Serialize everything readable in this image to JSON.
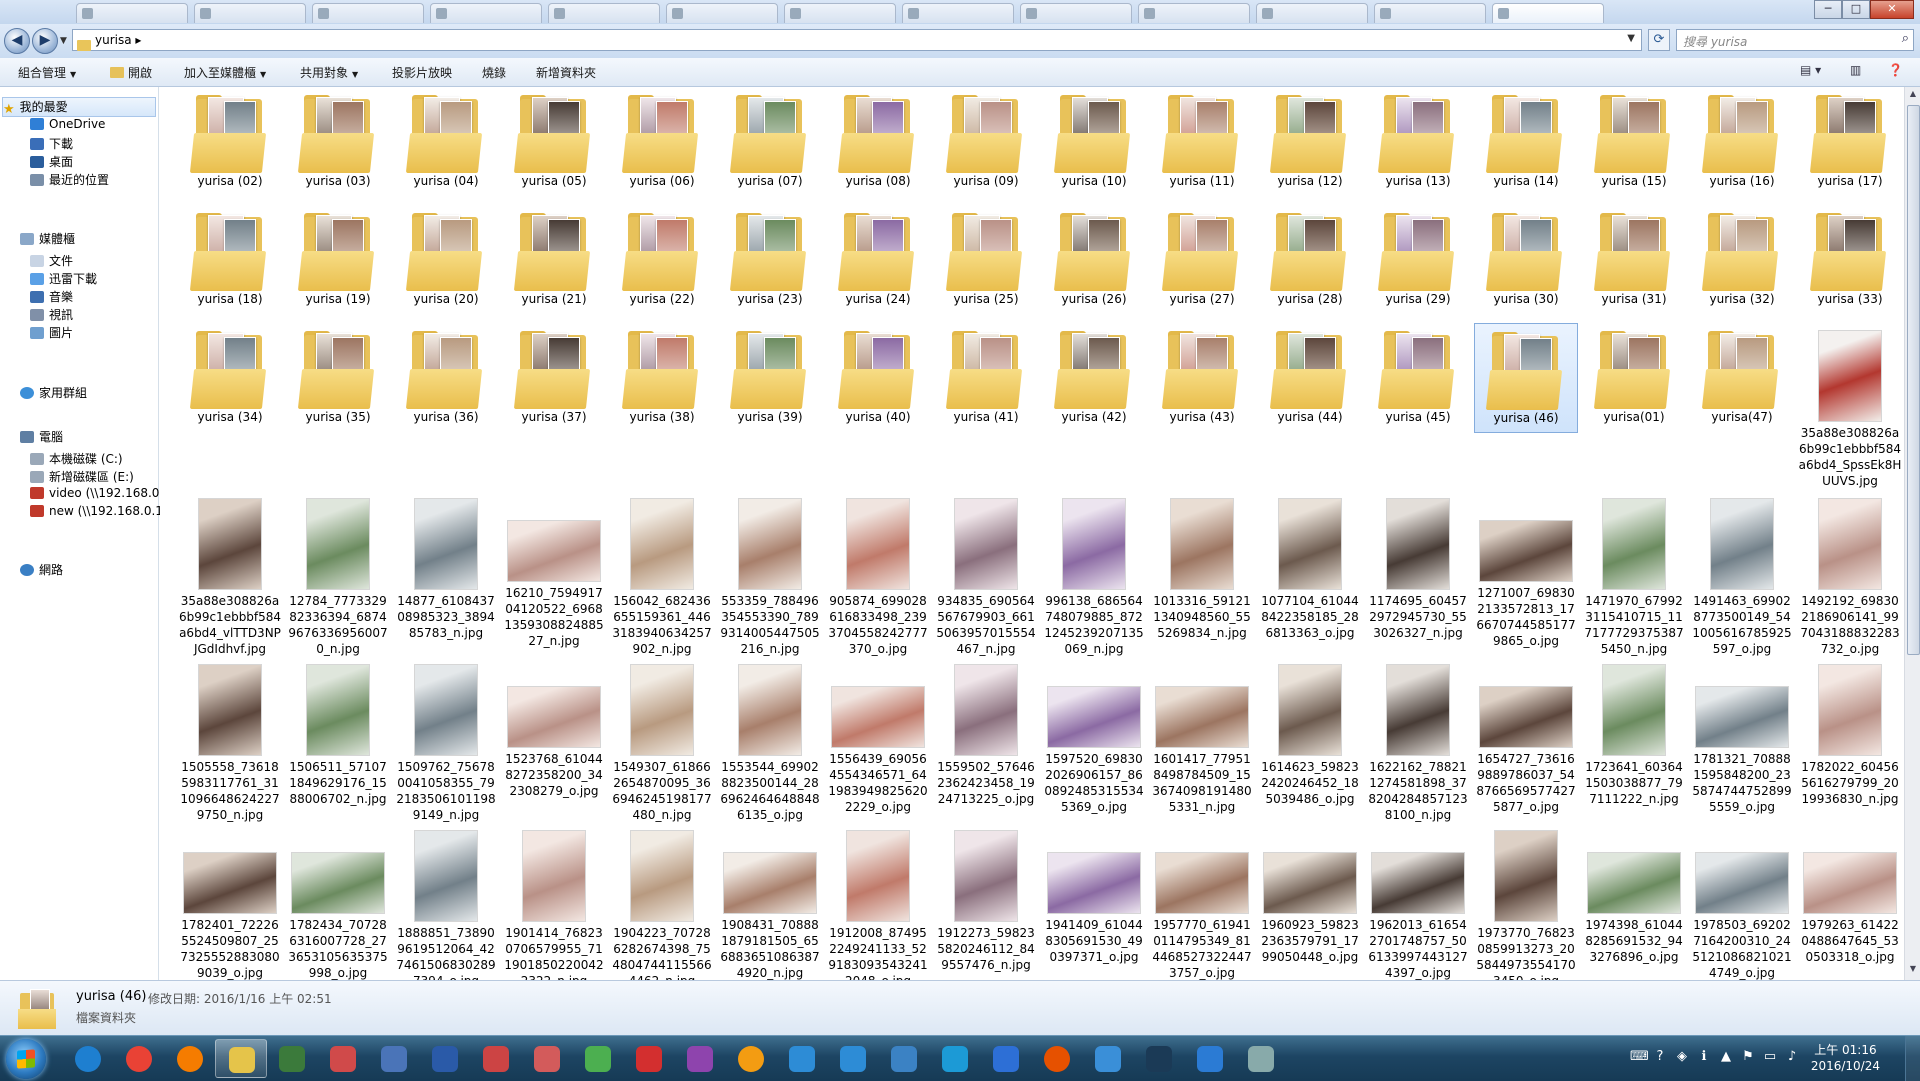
{
  "window": {
    "tabs": [
      "",
      "",
      "",
      "",
      "",
      "",
      "",
      "",
      "",
      "",
      "",
      "",
      ""
    ],
    "buttons": {
      "minimize": "─",
      "maximize": "□",
      "close": "✕"
    }
  },
  "nav": {
    "back_glyph": "◀",
    "forward_glyph": "▶",
    "breadcrumb": "yurisa",
    "search_placeholder": "搜尋 yurisa"
  },
  "toolbar": {
    "organize": "組合管理",
    "open": "開啟",
    "add_to_library": "加入至媒體櫃",
    "share_with": "共用對象",
    "slideshow": "投影片放映",
    "burn": "燒錄",
    "new_folder": "新增資料夾"
  },
  "sidebar": {
    "favorites": {
      "label": "我的最愛",
      "items": [
        "OneDrive",
        "下載",
        "桌面",
        "最近的位置"
      ]
    },
    "libraries": {
      "label": "媒體櫃",
      "items": [
        "文件",
        "迅雷下載",
        "音樂",
        "視訊",
        "圖片"
      ]
    },
    "homegroup": "家用群組",
    "computer": {
      "label": "電腦",
      "items": [
        "本機磁碟 (C:)",
        "新增磁碟區 (E:)",
        "video (\\\\192.168.0.",
        "new (\\\\192.168.0.1"
      ]
    },
    "network": "網路"
  },
  "folders_row1": [
    "yurisa (02)",
    "yurisa (03)",
    "yurisa (04)",
    "yurisa (05)",
    "yurisa (06)",
    "yurisa (07)",
    "yurisa (08)",
    "yurisa (09)",
    "yurisa (10)",
    "yurisa (11)",
    "yurisa (12)",
    "yurisa (13)",
    "yurisa (14)",
    "yurisa (15)",
    "yurisa (16)",
    "yurisa (17)"
  ],
  "folders_row2": [
    "yurisa (18)",
    "yurisa (19)",
    "yurisa (20)",
    "yurisa (21)",
    "yurisa (22)",
    "yurisa (23)",
    "yurisa (24)",
    "yurisa (25)",
    "yurisa (26)",
    "yurisa (27)",
    "yurisa (28)",
    "yurisa (29)",
    "yurisa (30)",
    "yurisa (31)",
    "yurisa (32)",
    "yurisa (33)"
  ],
  "folders_row3": [
    "yurisa (34)",
    "yurisa (35)",
    "yurisa (36)",
    "yurisa (37)",
    "yurisa (38)",
    "yurisa (39)",
    "yurisa (40)",
    "yurisa (41)",
    "yurisa (42)",
    "yurisa (43)",
    "yurisa (44)",
    "yurisa (45)",
    "yurisa (46)",
    "yurisa(01)",
    "yurisa(47)"
  ],
  "row3_file": "35a88e308826a6b99c1ebbbf584a6bd4_SpssEk8HUUVS.jpg",
  "files_row4": [
    "35a88e308826a6b99c1ebbbf584a6bd4_vlTTD3NPJGdIdhvf.jpg",
    "12784_777332982336394_687496763369560070_n.jpg",
    "14877_610843708985323_389485783_n.jpg",
    "16210_759491704120522_6968135930882488527_n.jpg",
    "156042_682436655159361_4463183940634257902_n.jpg",
    "553359_788496354553390_7899314005447505216_n.jpg",
    "905874_699028616833498_2393704558242777370_o.jpg",
    "934835_690564567679903_6615063957015554467_n.jpg",
    "996138_686564748079885_8721245239207135069_n.jpg",
    "1013316_591211340948560_555269834_n.jpg",
    "1077104_610448422358185_286813363_o.jpg",
    "1174695_604572972945730_553026327_n.jpg",
    "1271007_698302133572813_1766707445851779865_o.jpg",
    "1471970_679923115410715_1171777293753875450_n.jpg",
    "1491463_699028773500149_541005616785925597_o.jpg",
    "1492192_698302186906141_997043188832283732_o.jpg"
  ],
  "files_row5": [
    "1505558_736185983117761_311096648624227 9750_n.jpg",
    "1506511_571071849629176_1588006702_n.jpg",
    "1509762_756780041058355_792183506101198 9149_n.jpg",
    "1523768_610448272358200_342308279_o.jpg",
    "1549307_618662654870095_366946245198177480_n.jpg",
    "1553544_699028823500144_286962464648848 6135_o.jpg",
    "1556439_690564554346571_641983949825620 2229_o.jpg",
    "1559502_576462362423458_1924713225_o.jpg",
    "1597520_698302026906157_860892485315534 5369_o.jpg",
    "1601417_779518498784509_153674098191480 5331_n.jpg",
    "1614623_598232420246452_185039486_o.jpg",
    "1622162_788211274581898_378204284857123 8100_n.jpg",
    "1654727_736169889786037_548766569577427 5877_o.jpg",
    "1723641_603641503038877_797111222_n.jpg",
    "1781321_708881595848200_235874744752899 5559_o.jpg",
    "1782022_604565616279799_2019936830_n.jpg"
  ],
  "files_row6": [
    "1782401_722265524509807_257325552883080 9039_o.jpg",
    "1782434_707286316007728_273653105635375 998_o.jpg",
    "1888851_738909619512064_427461506830289 7394_o.jpg",
    "1901414_768230706579955_711901850220042 2322_n.jpg",
    "1904223_707286282674398_754804744115566 4462_n.jpg",
    "1908431_708881879181505_656883651086387 4920_n.jpg",
    "1912008_874952249241133_529183093543241 2048_o.jpg",
    "1912273_598235820246112_849557476_n.jpg",
    "1941409_610448305691530_490397371_o.jpg",
    "1957770_619410114795349_814468527322447 3757_o.jpg",
    "1960923_598232363579791_1799050448_o.jpg",
    "1962013_616542701748757_506133997443127 4397_o.jpg",
    "1973770_768230859913273_205844973554170 3450_o.jpg",
    "1974398_610448285691532_943276896_o.jpg",
    "1978503_692027164200310_245121086821021 4749_o.jpg",
    "1979263_614220488647645_530503318_o.jpg"
  ],
  "details": {
    "name": "yurisa (46)",
    "modified": "修改日期: 2016/1/16 上午 02:51",
    "type": "檔案資料夾"
  },
  "clock": {
    "time": "上午 01:16",
    "date": "2016/10/24"
  },
  "colors": {
    "accent": "#3399ff",
    "folder": "#e8c25a",
    "taskbar": "#1d4563"
  }
}
